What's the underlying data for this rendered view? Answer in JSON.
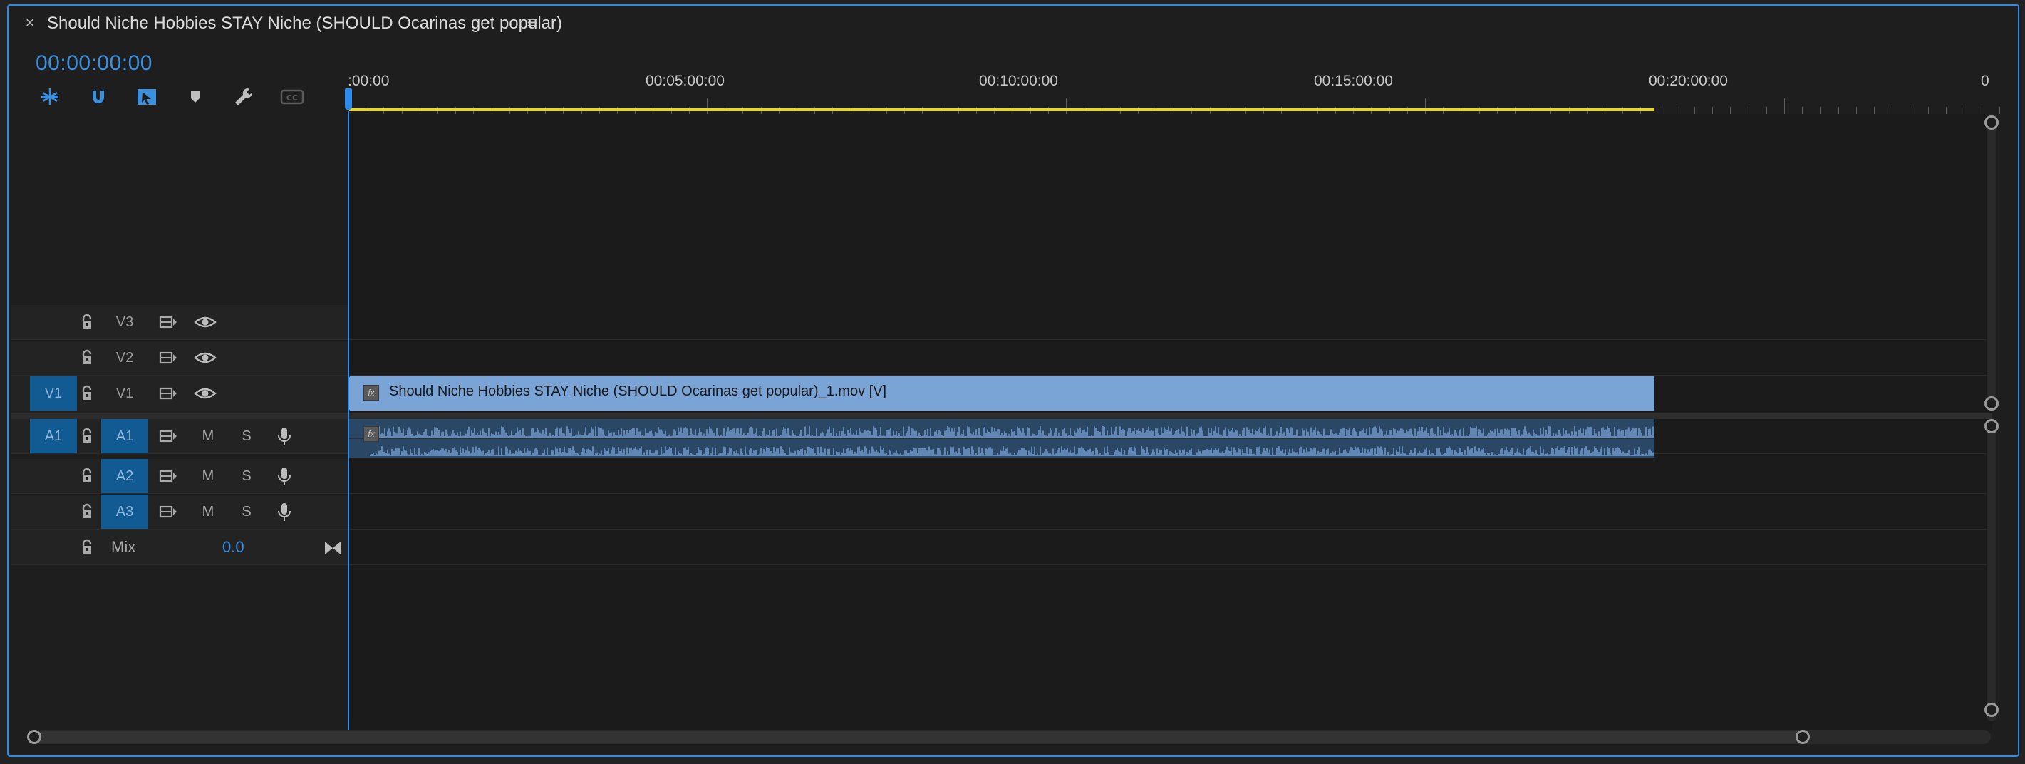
{
  "sequence": {
    "title": "Should Niche Hobbies STAY Niche (SHOULD Ocarinas get popular)",
    "close_label": "×",
    "menu_label": "≡",
    "timecode": "00:00:00:00"
  },
  "toolbar": {
    "items": [
      "insert-overwrite-icon",
      "snap-icon",
      "linked-selection-icon",
      "add-marker-icon",
      "settings-wrench-icon",
      "captions-icon"
    ]
  },
  "ruler": {
    "labels": [
      ":00:00",
      "00:05:00:00",
      "00:10:00:00",
      "00:15:00:00",
      "00:20:00:00",
      "0"
    ]
  },
  "tracks": {
    "v3": {
      "target": "V3"
    },
    "v2": {
      "target": "V2"
    },
    "v1": {
      "source": "V1",
      "target": "V1"
    },
    "a1": {
      "source": "A1",
      "target": "A1",
      "mute": "M",
      "solo": "S"
    },
    "a2": {
      "target": "A2",
      "mute": "M",
      "solo": "S"
    },
    "a3": {
      "target": "A3",
      "mute": "M",
      "solo": "S"
    },
    "mix": {
      "label": "Mix",
      "value": "0.0"
    }
  },
  "clips": {
    "video_name": "Should Niche Hobbies STAY Niche (SHOULD Ocarinas get popular)_1.mov [V]",
    "fx_badge": "fx"
  },
  "colors": {
    "accent": "#2d8ceb",
    "work_area": "#e7d624",
    "video_clip": "#7aa3d6",
    "audio_clip": "#2a4766",
    "waveform": "#7aa3d6"
  }
}
